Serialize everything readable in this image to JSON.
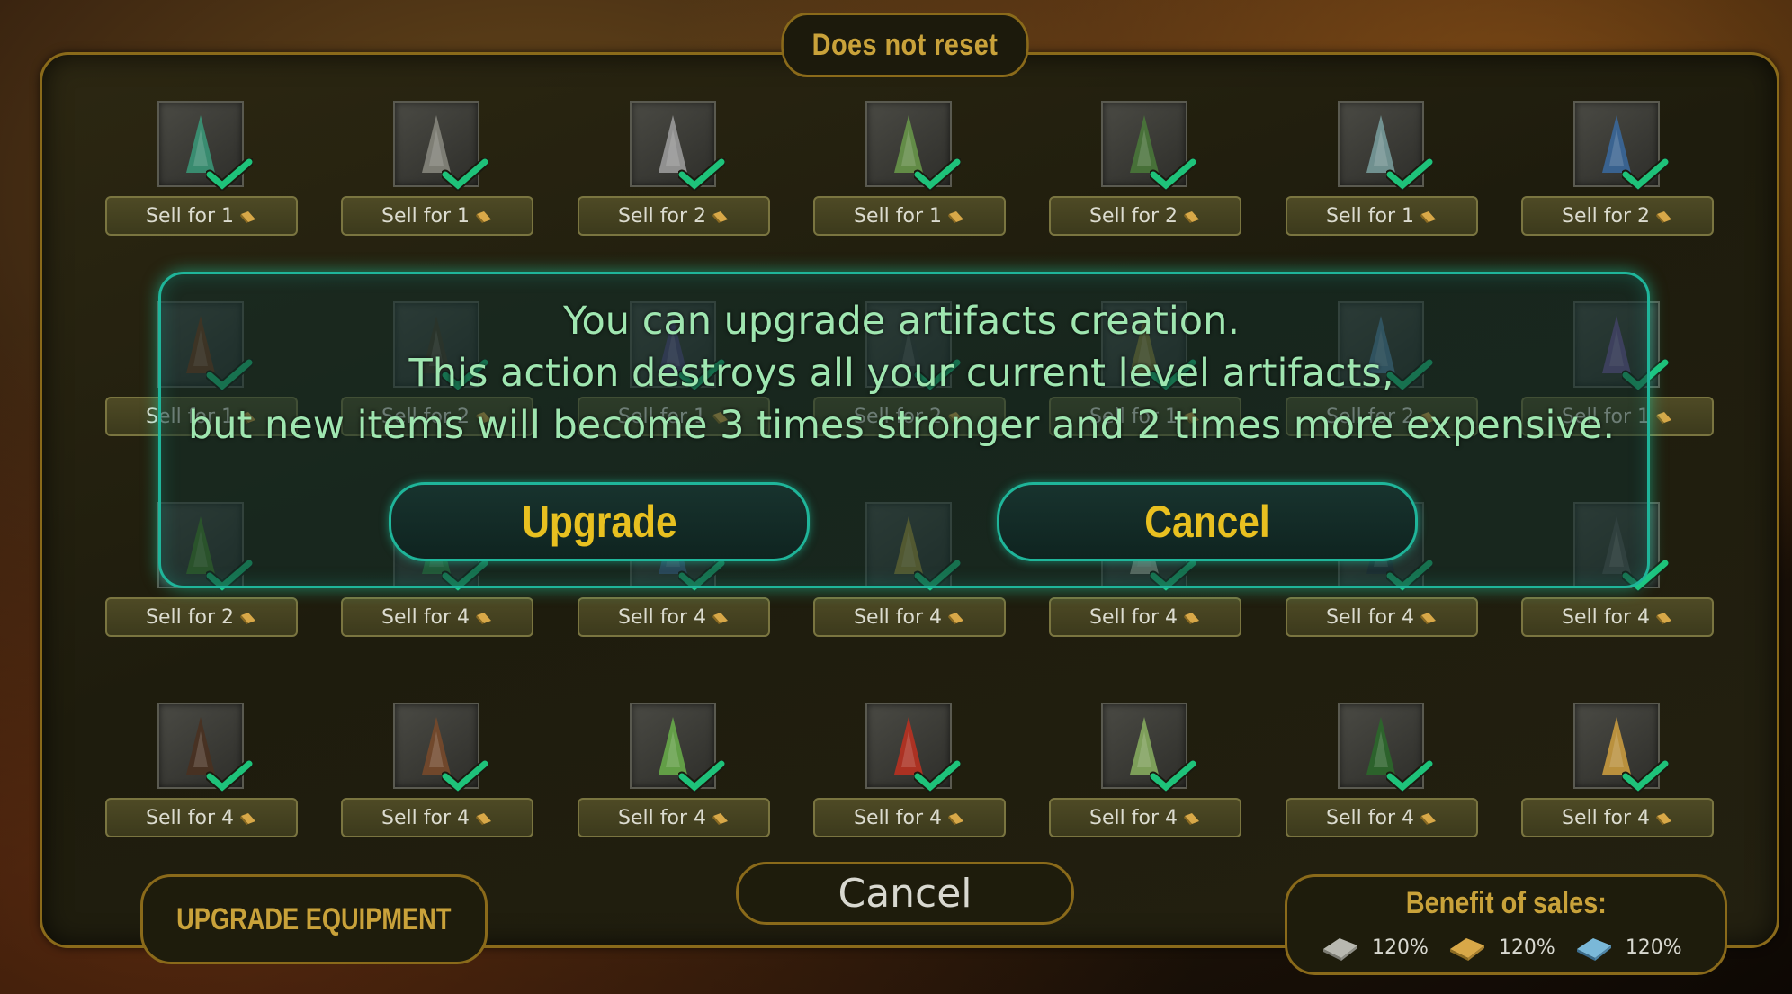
{
  "header": {
    "title": "Does not reset"
  },
  "items": [
    {
      "row": 0,
      "col": 0,
      "icon": "green-shield-icon",
      "price": "1",
      "visible": true
    },
    {
      "row": 0,
      "col": 1,
      "icon": "dagger-icon",
      "price": "1"
    },
    {
      "row": 0,
      "col": 2,
      "icon": "hook-icon",
      "price": "2"
    },
    {
      "row": 0,
      "col": 3,
      "icon": "green-feathers-icon",
      "price": "1"
    },
    {
      "row": 0,
      "col": 4,
      "icon": "green-sword-icon",
      "price": "2"
    },
    {
      "row": 0,
      "col": 5,
      "icon": "chain-sword-icon",
      "price": "1"
    },
    {
      "row": 0,
      "col": 6,
      "icon": "blue-blade-icon",
      "price": "2"
    },
    {
      "row": 1,
      "col": 0,
      "icon": "curved-horn-icon",
      "price": "1"
    },
    {
      "row": 1,
      "col": 1,
      "icon": "dark-blade-icon",
      "price": "2"
    },
    {
      "row": 1,
      "col": 2,
      "icon": "purple-item-icon",
      "price": "1"
    },
    {
      "row": 1,
      "col": 3,
      "icon": "dark-item-icon",
      "price": "2"
    },
    {
      "row": 1,
      "col": 4,
      "icon": "amulet-icon",
      "price": "1"
    },
    {
      "row": 1,
      "col": 5,
      "icon": "blue-flask-icon",
      "price": "2"
    },
    {
      "row": 1,
      "col": 6,
      "icon": "purple-potion-icon",
      "price": "1"
    },
    {
      "row": 2,
      "col": 0,
      "icon": "green-flask-icon",
      "price": "2"
    },
    {
      "row": 2,
      "col": 1,
      "icon": "green-potion-icon",
      "price": "4"
    },
    {
      "row": 2,
      "col": 2,
      "icon": "blue-potion-icon",
      "price": "4"
    },
    {
      "row": 2,
      "col": 3,
      "icon": "yellow-scroll-icon",
      "price": "4"
    },
    {
      "row": 2,
      "col": 4,
      "icon": "white-mask-icon",
      "price": "4"
    },
    {
      "row": 2,
      "col": 5,
      "icon": "dark-flask-icon",
      "price": "4"
    },
    {
      "row": 2,
      "col": 6,
      "icon": "wand-icon",
      "price": "4"
    },
    {
      "row": 3,
      "col": 0,
      "icon": "broom-icon",
      "price": "4"
    },
    {
      "row": 3,
      "col": 1,
      "icon": "staff-icon",
      "price": "4"
    },
    {
      "row": 3,
      "col": 2,
      "icon": "green-staff-icon",
      "price": "4"
    },
    {
      "row": 3,
      "col": 3,
      "icon": "red-robe-icon",
      "price": "4"
    },
    {
      "row": 3,
      "col": 4,
      "icon": "green-cloak-icon",
      "price": "4"
    },
    {
      "row": 3,
      "col": 5,
      "icon": "green-ring-icon",
      "price": "4"
    },
    {
      "row": 3,
      "col": 6,
      "icon": "golden-glove-icon",
      "price": "4"
    }
  ],
  "sell": {
    "label": "Sell  for"
  },
  "overlay": {
    "line1": "You can upgrade artifacts creation.",
    "line2": "This action destroys all your current level artifacts,",
    "line3": "but new items will become 3 times stronger and 2 times more expensive.",
    "upgrade_label": "Upgrade",
    "cancel_label": "Cancel"
  },
  "footer": {
    "cancel_label": "Cancel",
    "upgrade_equipment_label": "UPGRADE EQUIPMENT",
    "benefit_title": "Benefit of sales:",
    "benefits": [
      {
        "icon": "silver-bar-icon",
        "value": "120%"
      },
      {
        "icon": "gold-bar-icon",
        "value": "120%"
      },
      {
        "icon": "blue-bar-icon",
        "value": "120%"
      }
    ]
  },
  "colors": {
    "accent_gold": "#c9a23a",
    "overlay_teal": "#1fb59a",
    "overlay_text": "#9fe6b0",
    "button_text": "#e8c020"
  }
}
